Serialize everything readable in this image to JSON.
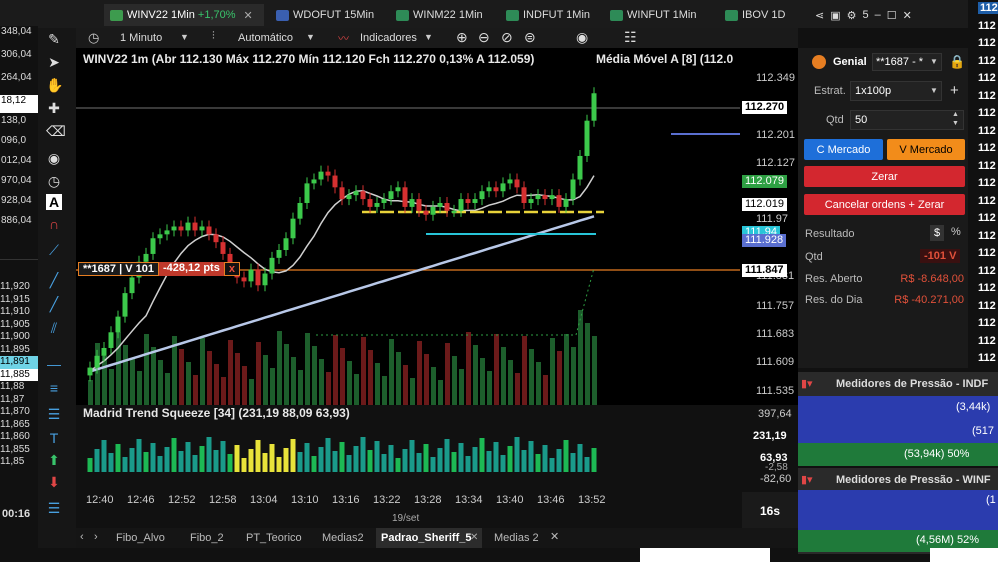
{
  "tabs": [
    {
      "label": "WINV22 1Min",
      "change": "+1,70%",
      "active": true
    },
    {
      "label": "WDOFUT 15Min"
    },
    {
      "label": "WINM22 1Min"
    },
    {
      "label": "INDFUT 1Min"
    },
    {
      "label": "WINFUT 1Min"
    },
    {
      "label": "IBOV 1D"
    }
  ],
  "window_controls": {
    "count": "5"
  },
  "toolbar": {
    "timeframe": "1 Minuto",
    "scale": "Automático",
    "indicators": "Indicadores"
  },
  "chart": {
    "header": "WINV22 1m (Abr 112.130 Máx 112.270 Mín 112.120 Fch 112.270 0,13% A 112.059)",
    "ma_label": "Média Móvel A [8] (112.0",
    "order_line": {
      "id": "**1687 | V 101",
      "pts": "-428,12 pts",
      "close": "x"
    },
    "price_axis": [
      "112.349",
      "112.201",
      "112.127",
      "111.97",
      "111.831",
      "111.757",
      "111.683",
      "111.609",
      "111.535"
    ],
    "price_tags": [
      {
        "value": "112.270",
        "color": "#ffffff",
        "bg": "#ffffff",
        "fg": "#000000"
      },
      {
        "value": "112.079",
        "bg": "#2ea043",
        "fg": "#ffffff"
      },
      {
        "value": "112.019",
        "bg": "#ffffff",
        "fg": "#000000"
      },
      {
        "value": "111.94",
        "bg": "#28c5d8",
        "fg": "#ffffff"
      },
      {
        "value": "111.928",
        "bg": "#5a6fd0",
        "fg": "#ffffff"
      },
      {
        "value": "111.847",
        "bg": "#ffffff",
        "fg": "#000000"
      }
    ],
    "indicator": {
      "label": "Madrid Trend Squeeze [34] (231,19 88,09 63,93)",
      "axis": [
        "397,64",
        "231,19",
        "63,93",
        "-2,58",
        "-82,60"
      ]
    },
    "time_axis": [
      "12:40",
      "12:46",
      "12:52",
      "12:58",
      "13:04",
      "13:10",
      "13:16",
      "13:22",
      "13:28",
      "13:34",
      "13:40",
      "13:46",
      "13:52"
    ],
    "date": "19/set",
    "countdown": "16s"
  },
  "left_axis": [
    "348,04",
    "306,04",
    "264,04",
    "18,12",
    "138,0",
    "096,0",
    "012,04",
    "970,04",
    "928,04",
    "886,04"
  ],
  "left_axis2": [
    "11,920",
    "11,915",
    "11,910",
    "11,905",
    "11,900",
    "11,895",
    "11,891",
    "11,885",
    "11,88",
    "11,87",
    "11,870",
    "11,865",
    "11,860",
    "11,855",
    "11,85"
  ],
  "left_time": "00:16",
  "bottom_tabs": [
    "Fibo_Alvo",
    "Fibo_2",
    "PT_Teorico",
    "Medias2",
    "Padrao_Sheriff_5",
    "Medias 2"
  ],
  "order_panel": {
    "broker": "Genial",
    "account": "**1687 - *",
    "estrat_label": "Estrat.",
    "estrat_value": "1x100p",
    "qtd_label": "Qtd",
    "qtd_value": "50",
    "buy": "C Mercado",
    "sell": "V Mercado",
    "zerar": "Zerar",
    "cancel": "Cancelar ordens + Zerar",
    "result_label": "Resultado",
    "result_currency": "$",
    "result_pct": "%",
    "qtd2_label": "Qtd",
    "qtd2_value": "-101 V",
    "aberto_label": "Res. Aberto",
    "aberto_value": "R$ -8.648,00",
    "dia_label": "Res. do Dia",
    "dia_value": "R$ -40.271,00"
  },
  "pressure": [
    {
      "title": "Medidores de Pressão - INDF",
      "rows": [
        "(3,44k)",
        "(517",
        "(53,94k) 50%"
      ]
    },
    {
      "title": "Medidores de Pressão - WINF",
      "rows": [
        "(1",
        "(4,56M) 52%"
      ]
    }
  ],
  "right_edge": [
    "112",
    "112",
    "112",
    "112",
    "112",
    "112",
    "112",
    "112",
    "112",
    "112",
    "112",
    "112",
    "112",
    "112",
    "112",
    "112",
    "112",
    "112",
    "112",
    "112",
    "112"
  ],
  "chart_data": {
    "type": "line",
    "close": [
      111.57,
      111.6,
      111.62,
      111.66,
      111.7,
      111.76,
      111.8,
      111.84,
      111.86,
      111.9,
      111.91,
      111.92,
      111.93,
      111.92,
      111.94,
      111.92,
      111.93,
      111.91,
      111.89,
      111.86,
      111.82,
      111.8,
      111.79,
      111.82,
      111.78,
      111.81,
      111.85,
      111.87,
      111.9,
      111.95,
      111.99,
      112.04,
      112.05,
      112.07,
      112.06,
      112.03,
      112.0,
      112.01,
      112.02,
      112.0,
      111.98,
      111.99,
      112.0,
      112.02,
      112.03,
      111.98,
      112.0,
      111.97,
      111.96,
      111.98,
      111.99,
      111.97,
      111.97,
      112.0,
      111.99,
      112.0,
      112.02,
      112.03,
      112.02,
      112.04,
      112.05,
      112.03,
      111.99,
      112.0,
      112.01,
      112.0,
      112.01,
      111.98,
      112.0,
      112.05,
      112.11,
      112.2,
      112.27
    ]
  }
}
